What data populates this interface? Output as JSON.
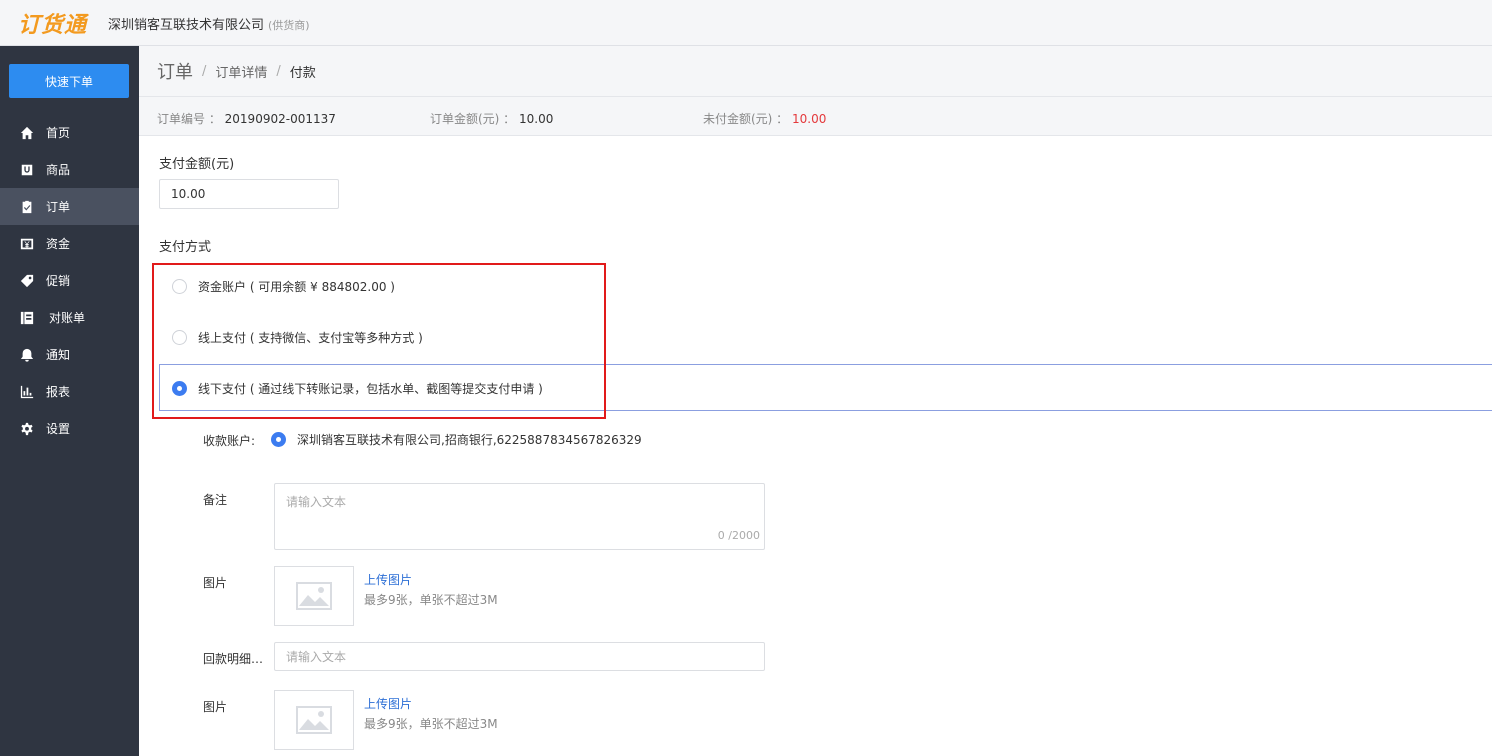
{
  "header": {
    "logo": "订货通",
    "company": "深圳销客互联技术有限公司",
    "role": "(供货商)"
  },
  "sidebar": {
    "quick_order": "快速下单",
    "items": [
      {
        "label": "首页",
        "icon": "home-icon"
      },
      {
        "label": "商品",
        "icon": "goods-icon"
      },
      {
        "label": "订单",
        "icon": "order-icon",
        "active": true
      },
      {
        "label": "资金",
        "icon": "fund-icon"
      },
      {
        "label": "促销",
        "icon": "tag-icon"
      },
      {
        "label": "对账单",
        "icon": "statement-icon"
      },
      {
        "label": "通知",
        "icon": "bell-icon"
      },
      {
        "label": "报表",
        "icon": "chart-icon"
      },
      {
        "label": "设置",
        "icon": "gear-icon"
      }
    ]
  },
  "breadcrumb": {
    "root": "订单",
    "sep": "/",
    "mid": "订单详情",
    "current": "付款"
  },
  "order_info": {
    "no_label": "订单编号 ：",
    "no_value": "20190902-001137",
    "amount_label": "订单金额(元) ：",
    "amount_value": "10.00",
    "unpaid_label": "未付金额(元) ：",
    "unpaid_value": "10.00",
    "unpaid_color": "#e4393c"
  },
  "payment": {
    "amount_label": "支付金额(元)",
    "amount_value": "10.00",
    "method_label": "支付方式",
    "options": [
      {
        "label": "资金账户 ( 可用余额 ¥ 884802.00 )",
        "selected": false
      },
      {
        "label": "线上支付 ( 支持微信、支付宝等多种方式 )",
        "selected": false
      },
      {
        "label": "线下支付 ( 通过线下转账记录，包括水单、截图等提交支付申请 )",
        "selected": true
      }
    ]
  },
  "offline_form": {
    "account_label": "收款账户:",
    "account_value": "深圳销客互联技术有限公司,招商银行,6225887834567826329",
    "remark_label": "备注",
    "remark_placeholder": "请输入文本",
    "remark_counter": "0 /2000",
    "image_label": "图片",
    "upload_text": "上传图片",
    "upload_hint": "最多9张，单张不超过3M",
    "detail_label": "回款明细…",
    "detail_placeholder": "请输入文本",
    "image2_label": "图片",
    "upload2_text": "上传图片",
    "upload2_hint": "最多9张，单张不超过3M"
  },
  "colors": {
    "accent": "#2d8cf0",
    "sidebar_bg": "#2f3541",
    "logo": "#f39a1f",
    "highlight": "#e11a1a"
  }
}
